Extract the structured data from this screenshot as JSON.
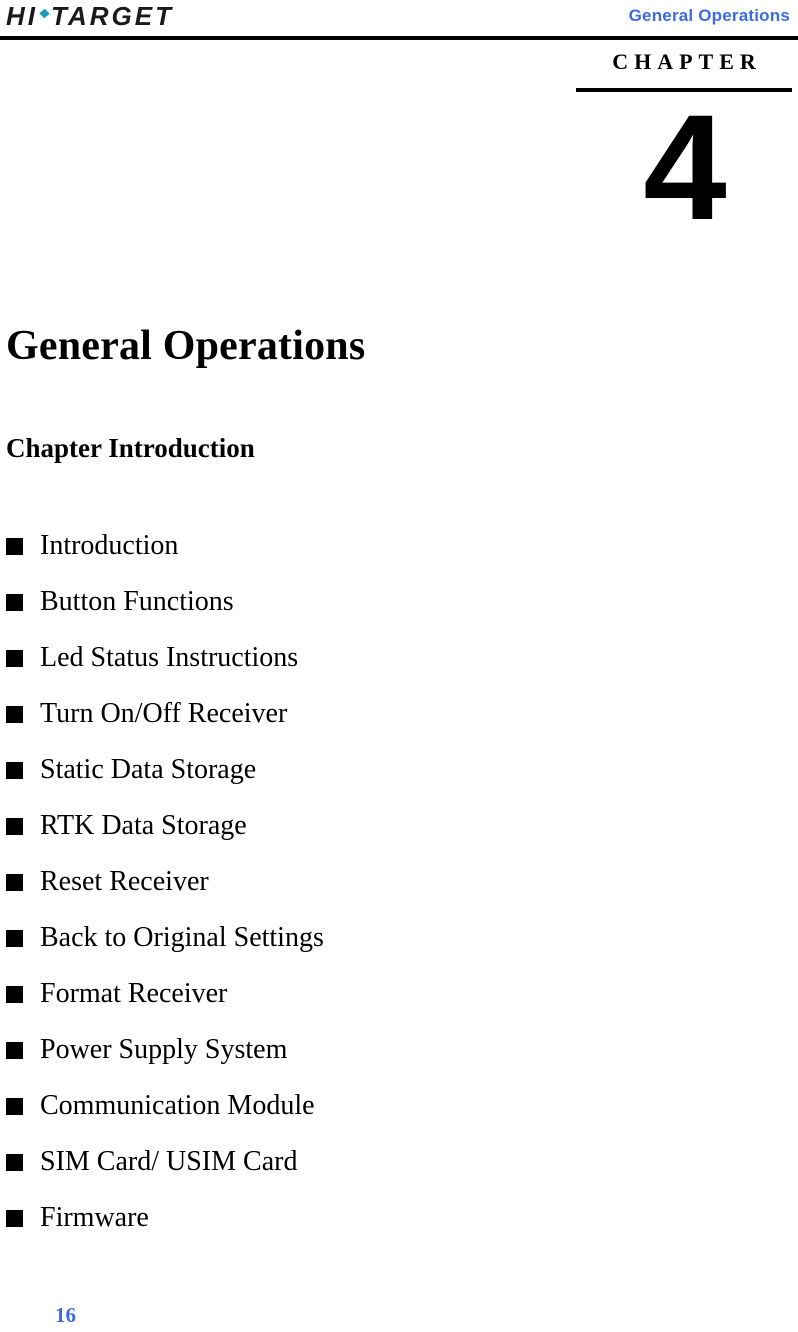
{
  "header": {
    "logo_text_left": "HI",
    "logo_separator_icon": "teal-diamond-dot",
    "logo_text_right": "TARGET",
    "running_title": "General Operations",
    "accent_color": "#3D6BE8",
    "logo_dot_color": "#1b9bb8"
  },
  "chapter": {
    "label": "CHAPTER",
    "number": "4"
  },
  "document": {
    "title": "General Operations",
    "section_heading": "Chapter Introduction"
  },
  "toc": {
    "bullet_icon": "filled-square-bullet",
    "items": [
      {
        "label": "Introduction"
      },
      {
        "label": "Button Functions"
      },
      {
        "label": "Led Status Instructions"
      },
      {
        "label": "Turn On/Off Receiver"
      },
      {
        "label": "Static Data Storage"
      },
      {
        "label": "RTK Data Storage"
      },
      {
        "label": "Reset Receiver"
      },
      {
        "label": "Back to Original Settings"
      },
      {
        "label": "Format Receiver"
      },
      {
        "label": "Power Supply System"
      },
      {
        "label": "Communication Module"
      },
      {
        "label": "SIM Card/ USIM Card"
      },
      {
        "label": "Firmware"
      }
    ]
  },
  "footer": {
    "page_number": "16"
  }
}
